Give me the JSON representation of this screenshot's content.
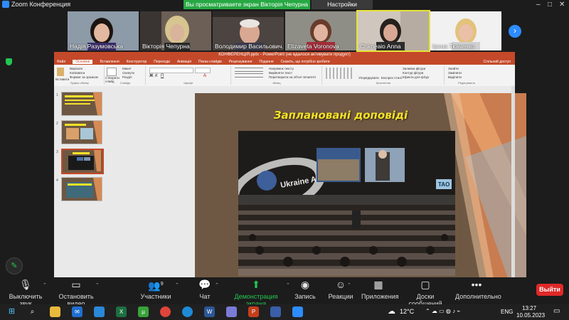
{
  "window": {
    "title": "Zoom Конференция",
    "banner": "Вы просматриваете экран Вікторія Чепурна",
    "view_options": "Настройки просмотра",
    "controls": [
      "–",
      "□",
      "✕"
    ]
  },
  "participants": [
    {
      "name": "Надія Разумовська"
    },
    {
      "name": "Вікторія Чепурна"
    },
    {
      "name": "Володимир Васильович..."
    },
    {
      "name": "Elizaveta Voronova"
    },
    {
      "name": "Chkneaio Anna"
    },
    {
      "name": "Ірина Ткаченко"
    }
  ],
  "powerpoint": {
    "title": "КОНФЕРЕНЦІЯ.pptx - PowerPoint (не вдалося активувати продукт)",
    "tabs": [
      "Файл",
      "Основне",
      "Вставлення",
      "Конструктор",
      "Переходи",
      "Анімація",
      "Показ слайдів",
      "Рецензування",
      "Подання",
      "Скажіть, що потрібно зробити"
    ],
    "active_tab": "Основне",
    "ribbon": {
      "clipboard": {
        "paste": "Вставити",
        "cut": "Вирізати",
        "copy": "Копіювати",
        "format": "Формат за зразком",
        "label": "Буфер обміну"
      },
      "slides": {
        "new": "Створити слайд",
        "layout": "Макет",
        "reset": "Скинути",
        "section": "Розділ",
        "label": "Слайди"
      },
      "font": {
        "label": "Шрифт"
      },
      "paragraph": {
        "label": "Абзац",
        "t1": "Напрямок тексту",
        "t2": "Вирівняти текст",
        "t3": "Перетворити на об'єкт SmartArt"
      },
      "drawing": {
        "label": "Креслення",
        "arrange": "Упорядкувати",
        "styles": "Експрес-стилі",
        "fill": "Заливка фігури",
        "outline": "Контур фігури",
        "effects": "Ефекти для фігур"
      },
      "editing": {
        "label": "Редагування",
        "find": "Знайти",
        "replace": "Замінити",
        "select": "Виділити"
      },
      "share": "Спільний доступ"
    },
    "slide_numbers": [
      "1",
      "2",
      "3",
      "4"
    ],
    "slide_title": "Заплановані доповіді",
    "photo_text": {
      "screen_logo": "Ukraine Assembly",
      "tag": "TAO"
    }
  },
  "toolbar": [
    {
      "label": "Выключить звук",
      "icon": "microphone-icon"
    },
    {
      "label": "Остановить видео",
      "icon": "video-camera-icon"
    },
    {
      "label": "Участники",
      "icon": "participants-icon",
      "count": "9"
    },
    {
      "label": "Чат",
      "icon": "chat-icon"
    },
    {
      "label": "Демонстрация экрана",
      "icon": "share-screen-icon"
    },
    {
      "label": "Запись",
      "icon": "record-icon"
    },
    {
      "label": "Реакции",
      "icon": "reactions-icon"
    },
    {
      "label": "Приложения",
      "icon": "apps-icon"
    },
    {
      "label": "Доски сообщений",
      "icon": "whiteboard-icon"
    },
    {
      "label": "Дополнительно",
      "icon": "more-icon"
    }
  ],
  "leave_label": "Выйти",
  "taskbar": {
    "temp": "12°C",
    "lang": "ENG",
    "time": "13:27",
    "date": "10.05.2023"
  },
  "colors": {
    "zoom_blue": "#2d8cff",
    "share_green": "#26a843",
    "ppt_red": "#c4492a",
    "leave_red": "#e02828",
    "slide_title_yellow": "#f2e229"
  }
}
